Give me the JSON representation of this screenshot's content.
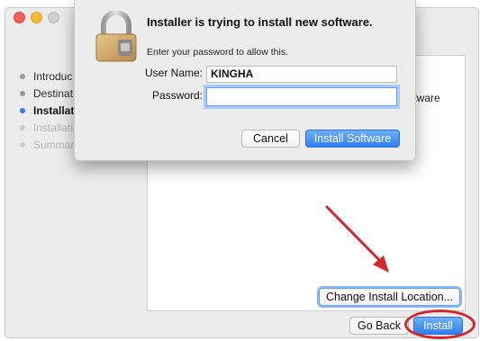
{
  "banner": {
    "text": "y the software"
  },
  "installer": {
    "steps": [
      {
        "label": "Introduc",
        "state": "done"
      },
      {
        "label": "Destinat",
        "state": "done"
      },
      {
        "label": "Installat",
        "state": "active"
      },
      {
        "label": "Installati",
        "state": "pending"
      },
      {
        "label": "Summar",
        "state": "pending"
      }
    ],
    "content_text": "ftware",
    "change_location_label": "Change Install Location...",
    "go_back_label": "Go Back",
    "install_label": "Install"
  },
  "auth_dialog": {
    "title": "Installer is trying to install new software.",
    "subtitle": "Enter your password to allow this.",
    "username_label": "User Name:",
    "username_value": "KINGHA",
    "password_label": "Password:",
    "password_value": "",
    "cancel_label": "Cancel",
    "install_software_label": "Install Software"
  },
  "colors": {
    "accent_blue": "#2e7ff0",
    "annotation_red": "#d9262c"
  }
}
